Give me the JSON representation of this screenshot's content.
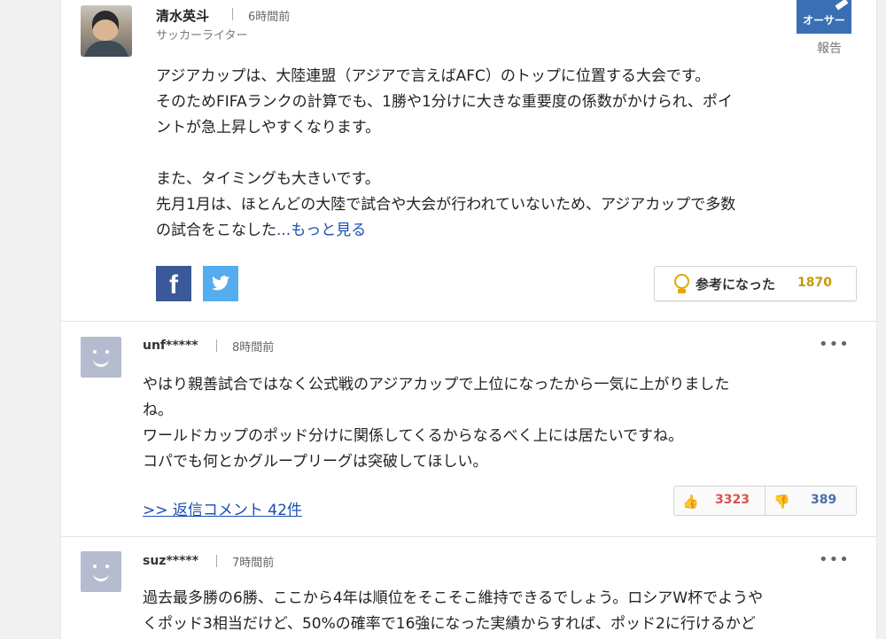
{
  "expert": {
    "name": "清水英斗",
    "time": "6時間前",
    "role": "サッカーライター",
    "badge": "オーサー",
    "report": "報告",
    "paragraphs": [
      [
        "アジアカップは、大陸連盟（アジアで言えばAFC）のトップに位置する大会です。",
        "そのためFIFAランクの計算でも、1勝や1分けに大きな重要度の係数がかけられ、ポイ",
        "ントが急上昇しやすくなります。"
      ],
      [
        "また、タイミングも大きいです。",
        "先月1月は、ほとんどの大陸で試合や大会が行われていないため、アジアカップで多数"
      ]
    ],
    "last_line": "の試合をこなした",
    "more": "...もっと見る",
    "helpful_label": "参考になった",
    "helpful_count": "1870"
  },
  "comments": [
    {
      "user": "unf*****",
      "time": "8時間前",
      "menu": "•••",
      "lines": [
        "やはり親善試合ではなく公式戦のアジアカップで上位になったから一気に上がりました",
        "ね。",
        "ワールドカップのポッド分けに関係してくるからなるべく上には居たいですね。",
        "コパでも何とかグループリーグは突破してほしい。"
      ],
      "reply_link": ">> 返信コメント 42件",
      "up": "3323",
      "down": "389"
    },
    {
      "user": "suz*****",
      "time": "7時間前",
      "menu": "•••",
      "lines": [
        "過去最多勝の6勝、ここから4年は順位をそこそこ維持できるでしょう。ロシアW杯でようや",
        "くポッド3相当だけど、50%の確率で16強になった実績からすれば、ポッド2に行けるかど"
      ]
    }
  ]
}
